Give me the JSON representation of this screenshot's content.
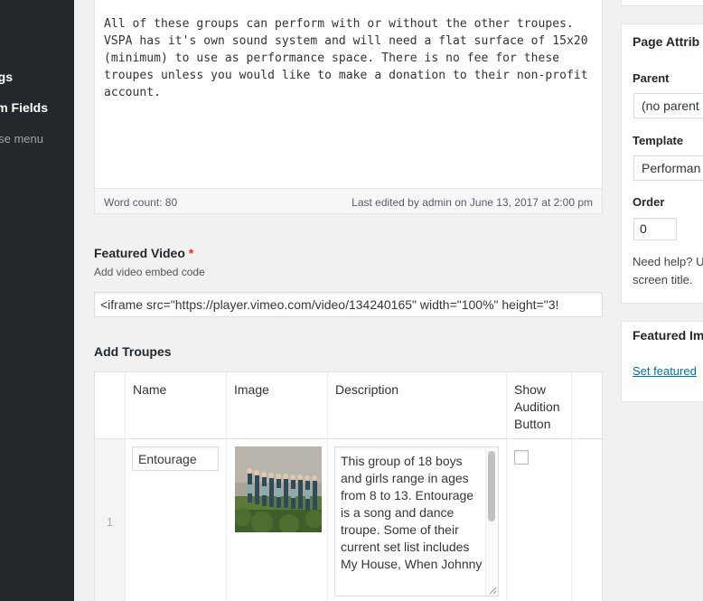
{
  "admin_menu": {
    "items": [
      {
        "label": "gs"
      },
      {
        "label": "m Fields"
      },
      {
        "label": "se menu"
      }
    ]
  },
  "editor": {
    "content": "All of these groups can perform with or without the other troupes.\nVSPA has it's own sound system and will need a flat surface of 15x20\n(minimum) to use as performance space. There is no fee for these\ntroupes unless you would like to make a donation to their non-profit\naccount.",
    "word_count": "Word count: 80",
    "last_edited": "Last edited by admin on June 13, 2017 at 2:00 pm"
  },
  "featured_video": {
    "label": "Featured Video",
    "required_mark": "*",
    "description": "Add video embed code",
    "value": "<iframe src=\"https://player.vimeo.com/video/134240165\" width=\"100%\" height=\"3!"
  },
  "troupes": {
    "label": "Add Troupes",
    "columns": [
      "Name",
      "Image",
      "Description",
      "Show Audition Button"
    ],
    "rows": [
      {
        "number": "1",
        "name": "Entourage",
        "description": "This group of 18 boys and girls range in ages from 8 to 13. Entourage is a song and dance troupe. Some of their current set list includes My House, When Johnny",
        "show_audition": false
      }
    ]
  },
  "page_attributes": {
    "title": "Page Attrib",
    "parent_label": "Parent",
    "parent_value": "(no parent",
    "template_label": "Template",
    "template_value": "Performan",
    "order_label": "Order",
    "order_value": "0",
    "help_line1": "Need help? U",
    "help_line2": "screen title."
  },
  "featured_image": {
    "title": "Featured Im",
    "link": "Set featured"
  }
}
